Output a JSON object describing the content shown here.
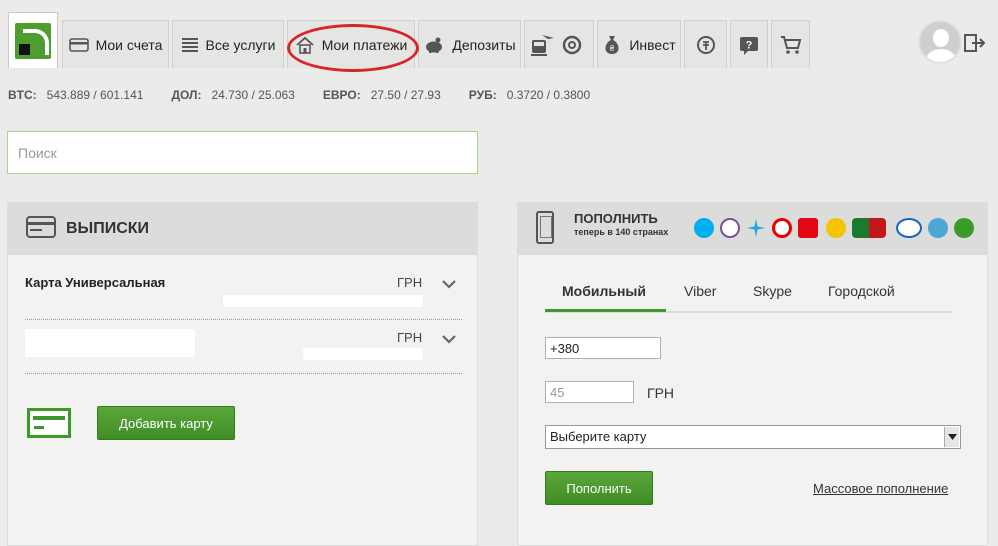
{
  "nav": {
    "tabs": [
      {
        "label": "Мои счета",
        "icon": "wallet-icon"
      },
      {
        "label": "Все услуги",
        "icon": "list-icon"
      },
      {
        "label": "Мои платежи",
        "icon": "house-icon"
      },
      {
        "label": "Депозиты",
        "icon": "piggy-bank-icon"
      },
      {
        "label": "",
        "icon": "travel-icon"
      },
      {
        "label": "Инвест",
        "icon": "money-bag-icon"
      },
      {
        "label": "",
        "icon": "currency-exchange-icon"
      },
      {
        "label": "",
        "icon": "help-icon"
      },
      {
        "label": "",
        "icon": "cart-icon"
      }
    ],
    "highlight_color": "#d8242b"
  },
  "rates": [
    {
      "code": "BTC:",
      "value": "543.889 / 601.141"
    },
    {
      "code": "ДОЛ:",
      "value": "24.730 / 25.063"
    },
    {
      "code": "ЕВРО:",
      "value": "27.50 / 27.93"
    },
    {
      "code": "РУБ:",
      "value": "0.3720 / 0.3800"
    }
  ],
  "search": {
    "placeholder": "Поиск"
  },
  "statements": {
    "title": "ВЫПИСКИ",
    "cards": [
      {
        "name": "Карта Универсальная",
        "currency": "ГРН"
      },
      {
        "name": "",
        "currency": "ГРН"
      }
    ],
    "add_card_label": "Добавить карту"
  },
  "topup": {
    "title": "ПОПОЛНИТЬ",
    "subtitle": "теперь в 140 странах",
    "operators": [
      "skype-icon",
      "viber-icon",
      "kyivstar-icon",
      "vodafone-icon",
      "mts-icon",
      "life-icon",
      "intertelecom-icon",
      "utel-icon",
      "people-net-icon",
      "globe-icon"
    ],
    "tabs": [
      "Мобильный",
      "Viber",
      "Skype",
      "Городской"
    ],
    "active_tab": "Мобильный",
    "phone_value": "+380",
    "amount_placeholder": "45",
    "currency": "ГРН",
    "card_select": "Выберите карту",
    "submit_label": "Пополнить",
    "mass_link": "Массовое пополнение"
  },
  "colors": {
    "accent": "#3a9a2a",
    "brand_green": "#4d9e2e"
  }
}
